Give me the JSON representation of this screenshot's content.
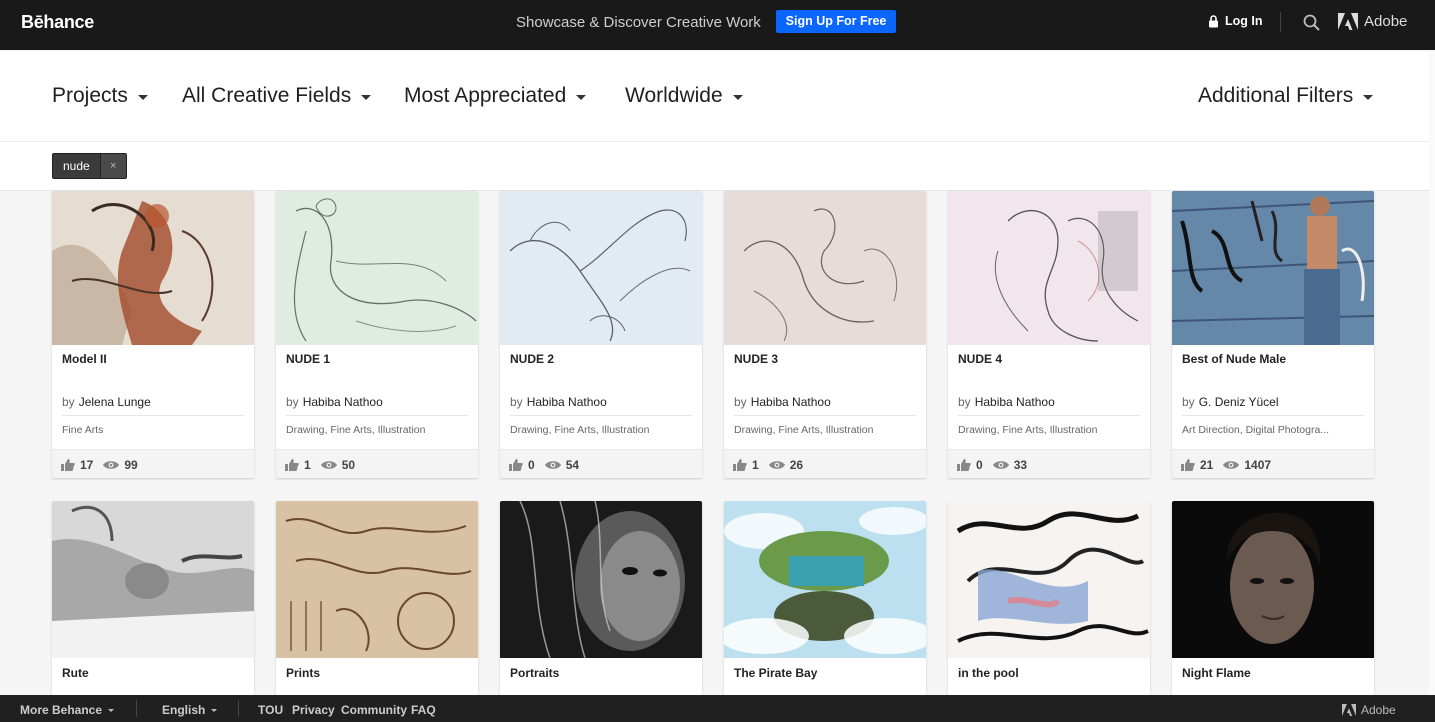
{
  "header": {
    "logo": "Bēhance",
    "tagline": "Showcase & Discover Creative Work",
    "signup_label": "Sign Up For Free",
    "login_label": "Log In",
    "adobe_label": "Adobe"
  },
  "filters": {
    "projects": "Projects",
    "fields": "All Creative Fields",
    "sort": "Most Appreciated",
    "location": "Worldwide",
    "additional": "Additional Filters"
  },
  "active_tag": {
    "label": "nude",
    "remove": "×"
  },
  "projects": [
    {
      "title": "Model II",
      "by": "by",
      "author": "Jelena Lunge",
      "fields": "Fine Arts",
      "appreciations": "17",
      "views": "99"
    },
    {
      "title": "NUDE 1",
      "by": "by",
      "author": "Habiba Nathoo",
      "fields": "Drawing, Fine Arts, Illustration",
      "appreciations": "1",
      "views": "50"
    },
    {
      "title": "NUDE 2",
      "by": "by",
      "author": "Habiba Nathoo",
      "fields": "Drawing, Fine Arts, Illustration",
      "appreciations": "0",
      "views": "54"
    },
    {
      "title": "NUDE 3",
      "by": "by",
      "author": "Habiba Nathoo",
      "fields": "Drawing, Fine Arts, Illustration",
      "appreciations": "1",
      "views": "26"
    },
    {
      "title": "NUDE 4",
      "by": "by",
      "author": "Habiba Nathoo",
      "fields": "Drawing, Fine Arts, Illustration",
      "appreciations": "0",
      "views": "33"
    },
    {
      "title": "Best of Nude Male",
      "by": "by",
      "author": "G. Deniz Yücel",
      "fields": "Art Direction, Digital Photogra...",
      "appreciations": "21",
      "views": "1407"
    }
  ],
  "projects_row2": [
    {
      "title": "Rute"
    },
    {
      "title": "Prints"
    },
    {
      "title": "Portraits"
    },
    {
      "title": "The Pirate Bay"
    },
    {
      "title": "in the pool"
    },
    {
      "title": "Night Flame"
    }
  ],
  "footer": {
    "more": "More Behance",
    "language": "English",
    "tou": "TOU",
    "privacy": "Privacy",
    "community": "Community",
    "faq": "FAQ",
    "adobe": "Adobe"
  },
  "colors": {
    "topbar": "#191919",
    "signup": "#0a66ff",
    "footer": "#202020"
  }
}
